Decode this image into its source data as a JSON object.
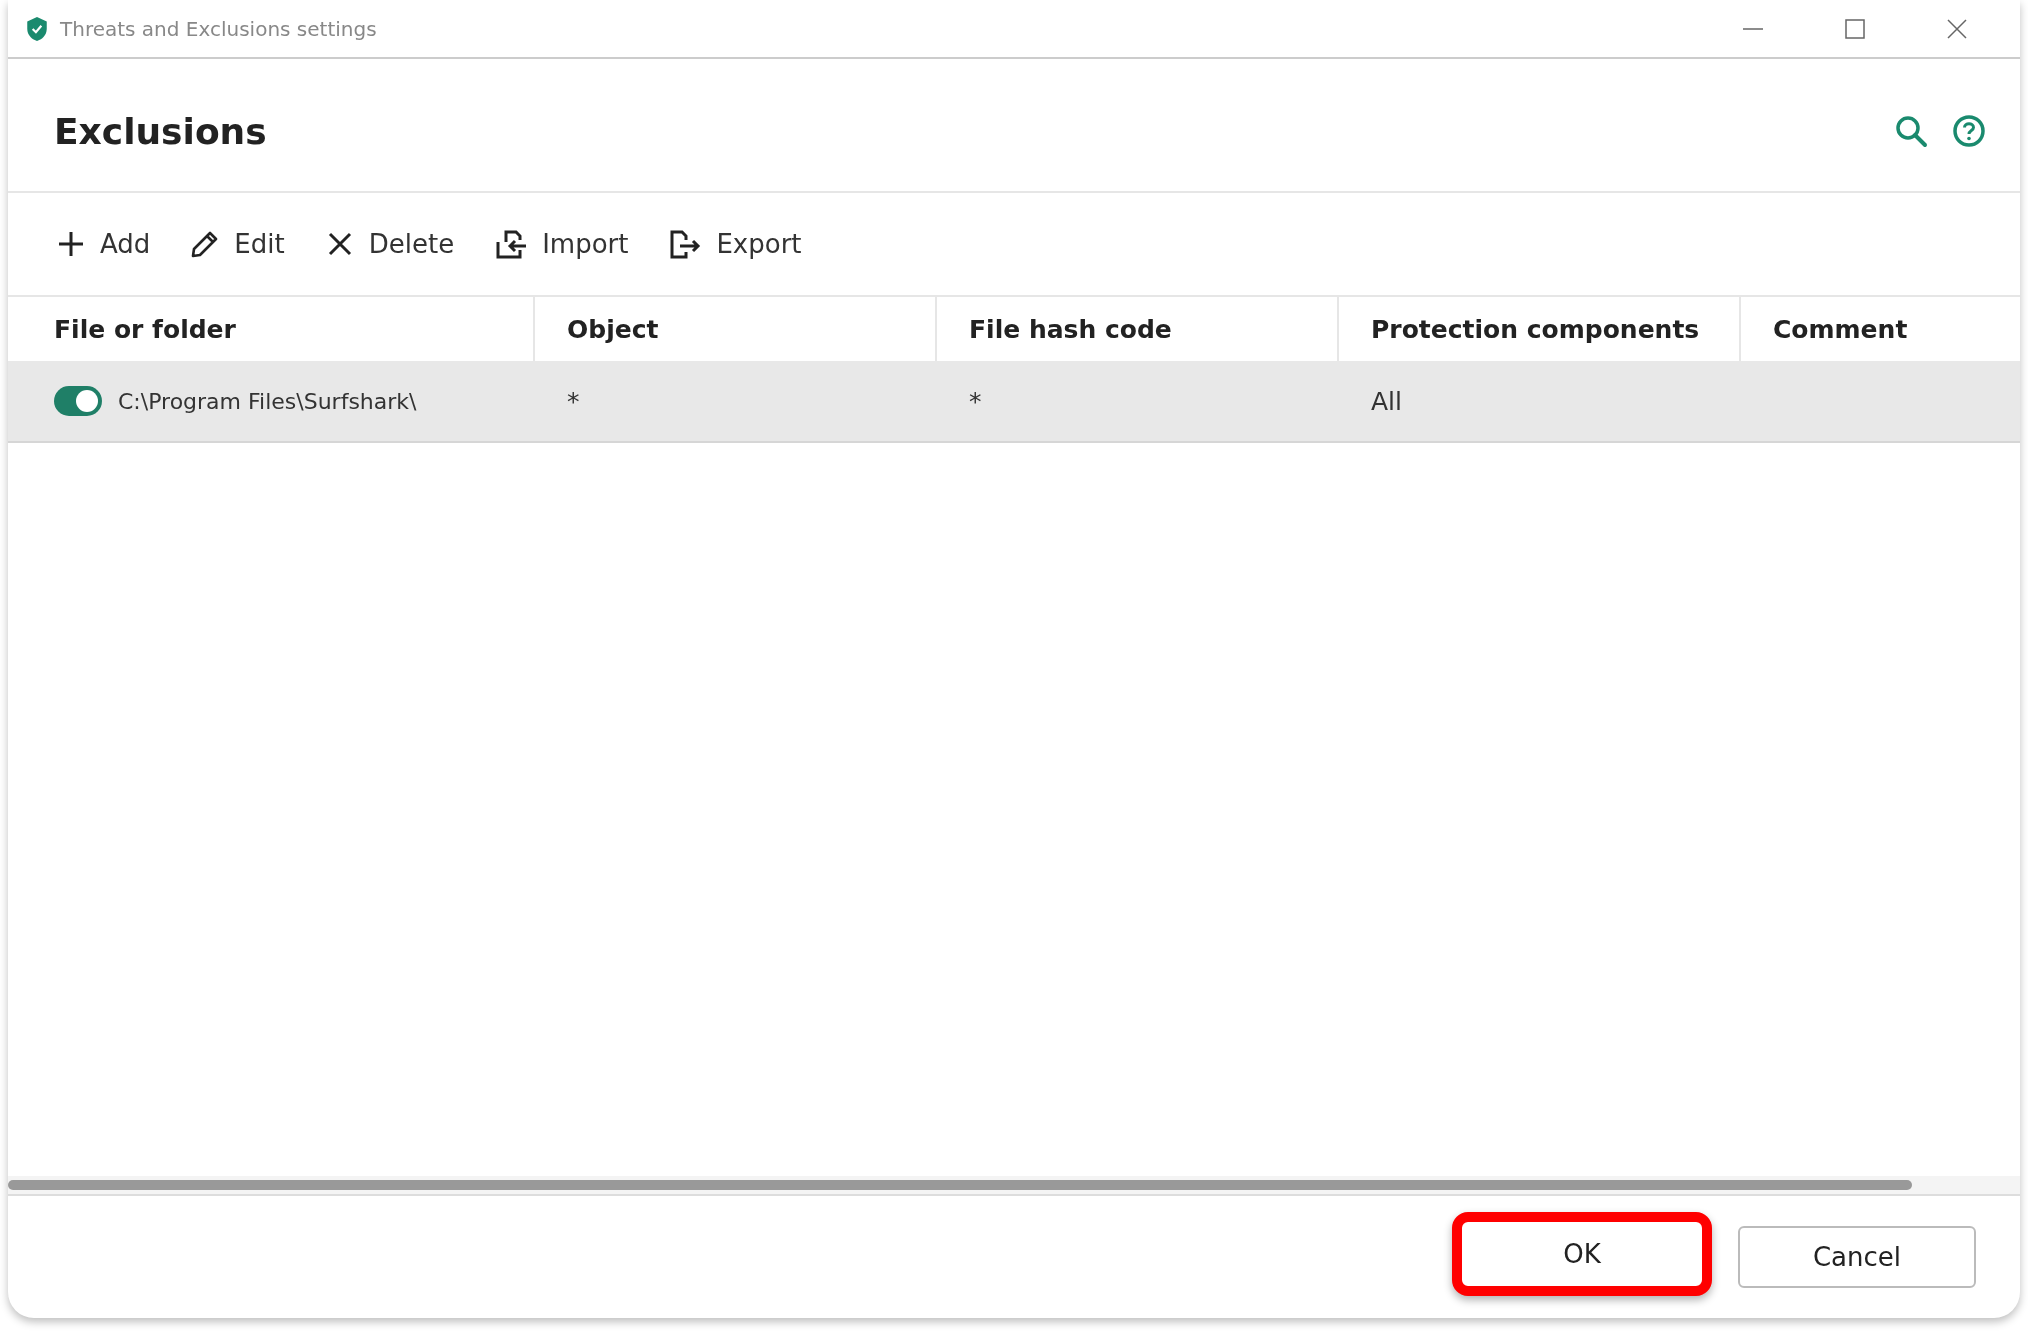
{
  "window": {
    "title": "Threats and Exclusions settings"
  },
  "header": {
    "title": "Exclusions"
  },
  "toolbar": [
    {
      "kind": "add",
      "label": "Add"
    },
    {
      "kind": "edit",
      "label": "Edit"
    },
    {
      "kind": "delete",
      "label": "Delete"
    },
    {
      "kind": "import",
      "label": "Import"
    },
    {
      "kind": "export",
      "label": "Export"
    }
  ],
  "table": {
    "columns": [
      "File or folder",
      "Object",
      "File hash code",
      "Protection components",
      "Comment"
    ],
    "rows": [
      {
        "on": true,
        "selected": true,
        "cells": [
          "C:\\Program Files\\Surfshark\\",
          "*",
          "*",
          "All",
          ""
        ]
      }
    ]
  },
  "buttons": [
    {
      "label": "OK",
      "highlighted": true
    },
    {
      "label": "Cancel",
      "highlighted": false
    }
  ]
}
